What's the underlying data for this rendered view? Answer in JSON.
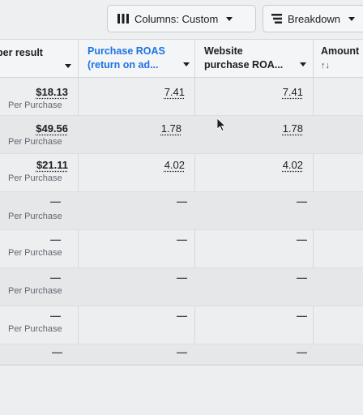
{
  "toolbar": {
    "columns_label": "Columns: Custom",
    "breakdown_label": "Breakdown"
  },
  "table": {
    "headers": {
      "cost_per_result": "per result",
      "purchase_roas_line1": "Purchase ROAS",
      "purchase_roas_line2": "(return on ad...",
      "website_roas_line1": "Website",
      "website_roas_line2": "purchase ROA...",
      "amount": "Amount",
      "amount_sort": "↑↓"
    },
    "rows": [
      {
        "cost": "$18.13",
        "cost_sub": "Per Purchase",
        "roas": "7.41",
        "website_roas": "7.41"
      },
      {
        "cost": "$49.56",
        "cost_sub": "Per Purchase",
        "roas": "1.78",
        "website_roas": "1.78"
      },
      {
        "cost": "$21.11",
        "cost_sub": "Per Purchase",
        "roas": "4.02",
        "website_roas": "4.02"
      },
      {
        "cost": "—",
        "cost_sub": "Per Purchase",
        "roas": "—",
        "website_roas": "—"
      },
      {
        "cost": "—",
        "cost_sub": "Per Purchase",
        "roas": "—",
        "website_roas": "—"
      },
      {
        "cost": "—",
        "cost_sub": "Per Purchase",
        "roas": "—",
        "website_roas": "—"
      },
      {
        "cost": "—",
        "cost_sub": "Per Purchase",
        "roas": "—",
        "website_roas": "—"
      },
      {
        "cost": "—",
        "cost_sub": "",
        "roas": "—",
        "website_roas": "—"
      }
    ]
  }
}
